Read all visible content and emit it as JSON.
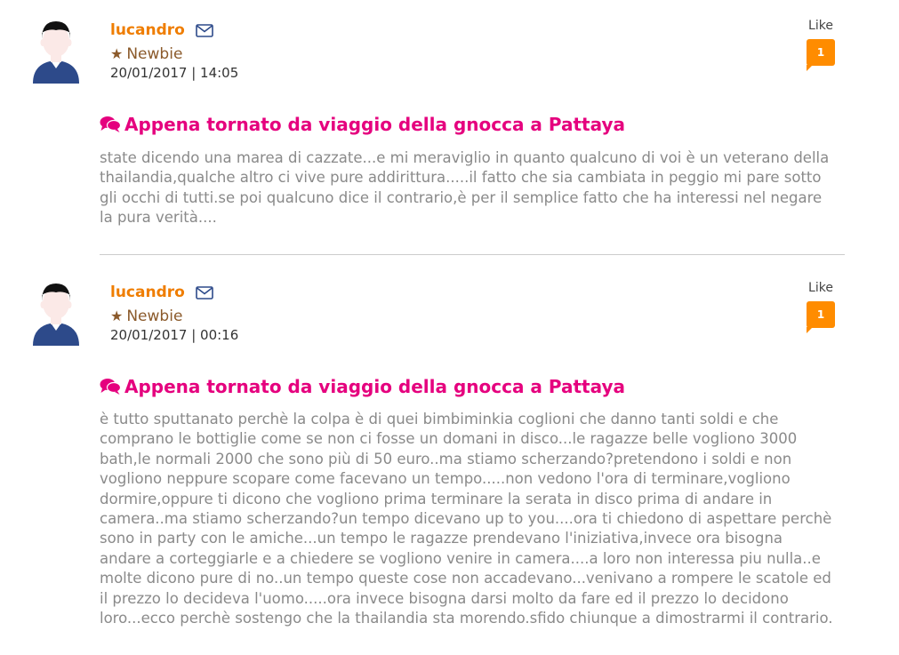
{
  "colors": {
    "username": "#ef7d00",
    "title": "#e5007e",
    "like_badge": "#ff8c00",
    "avatar_shirt": "#2d4a8a",
    "rank": "#8b5a2b",
    "body_text": "#8a8a8a"
  },
  "posts": [
    {
      "username": "lucandro",
      "rank": "Newbie",
      "date": "20/01/2017 | 14:05",
      "like_label": "Like",
      "like_count": "1",
      "title": "Appena tornato da viaggio della gnocca a Pattaya",
      "body": "state dicendo una marea di cazzate...e mi meraviglio in quanto qualcuno di voi è un veterano della thailandia,qualche altro ci vive pure addirittura.....il fatto che sia cambiata in peggio mi pare sotto gli occhi di tutti.se poi qualcuno dice il contrario,è per il semplice fatto che ha interessi nel negare la pura verità...."
    },
    {
      "username": "lucandro",
      "rank": "Newbie",
      "date": "20/01/2017 | 00:16",
      "like_label": "Like",
      "like_count": "1",
      "title": "Appena tornato da viaggio della gnocca a Pattaya",
      "body": "è tutto sputtanato perchè la colpa è di quei bimbiminkia coglioni che danno tanti soldi e che comprano le bottiglie come se non ci fosse un domani in disco...le ragazze belle vogliono 3000 bath,le normali 2000 che sono più di 50 euro..ma stiamo scherzando?pretendono i soldi e non vogliono neppure scopare come facevano un tempo.....non vedono l'ora di terminare,vogliono dormire,oppure ti dicono che vogliono prima terminare la serata in disco prima di andare in camera..ma stiamo scherzando?un tempo dicevano up to you....ora ti chiedono di aspettare perchè sono in party con le amiche...un tempo le ragazze prendevano l'iniziativa,invece ora bisogna andare a corteggiarle e a chiedere se vogliono venire in camera....a loro non interessa piu nulla..e molte dicono pure di no..un tempo queste cose non accadevano...venivano a rompere le scatole ed il prezzo lo decideva l'uomo.....ora invece bisogna darsi molto da fare ed il prezzo lo decidono loro...ecco perchè sostengo che la thailandia sta morendo.sfido chiunque a dimostrarmi il contrario."
    }
  ]
}
